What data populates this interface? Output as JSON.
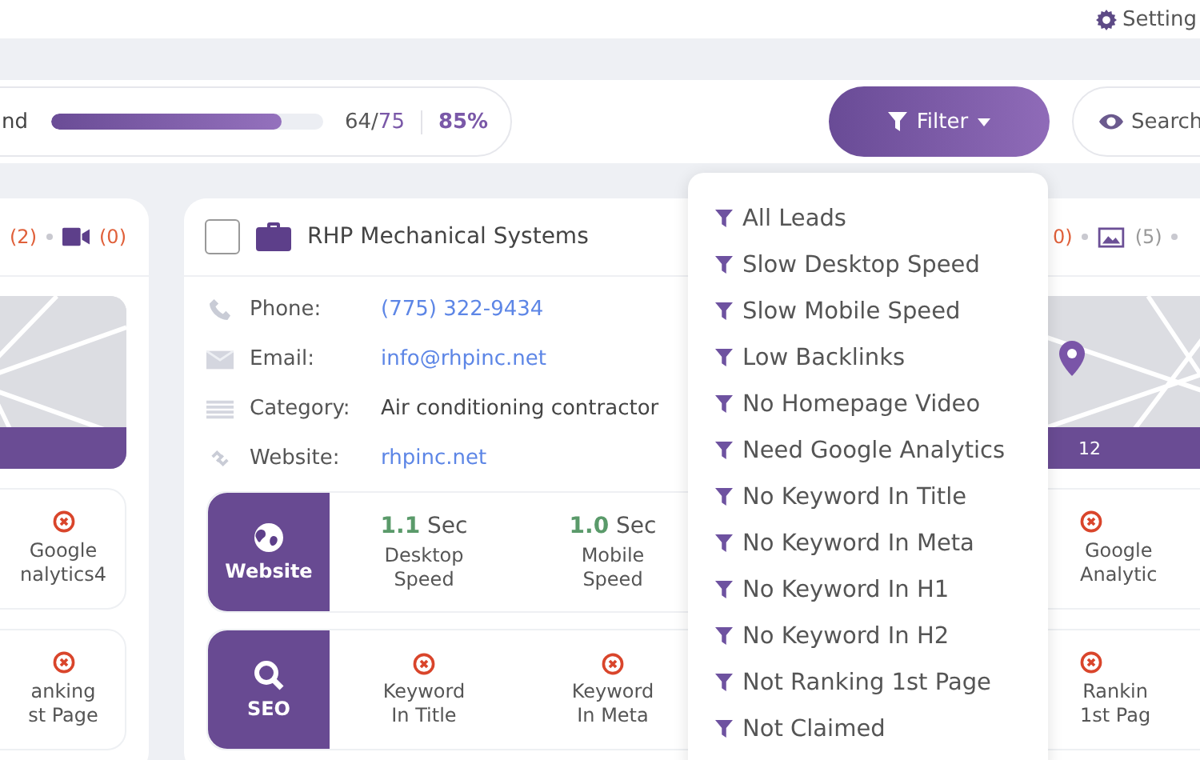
{
  "header": {
    "settings_label": "Setting"
  },
  "progress": {
    "label": "nd",
    "level": 0.85,
    "count": "64/",
    "total": "75",
    "percent": "85%"
  },
  "toolbar": {
    "filter_label": "Filter",
    "search_label": "Search"
  },
  "filter_menu": {
    "items": [
      "All Leads",
      "Slow Desktop Speed",
      "Slow Mobile Speed",
      "Low Backlinks",
      "No Homepage Video",
      "Need Google Analytics",
      "No Keyword In Title",
      "No Keyword In Meta",
      "No Keyword In H1",
      "No Keyword In H2",
      "Not Ranking 1st Page",
      "Not Claimed"
    ]
  },
  "left_card": {
    "counts": [
      {
        "kind": "plain",
        "text": "(2)",
        "color": "#e0603a"
      },
      {
        "kind": "video",
        "text": "(0)",
        "color": "#e0603a"
      }
    ],
    "checks": [
      {
        "caption": "Google\nnalytics4",
        "passed": false
      },
      {
        "caption": "anking\nst Page",
        "passed": false
      }
    ]
  },
  "main_card": {
    "checked": false,
    "title": "RHP Mechanical Systems",
    "fields": [
      {
        "kind": "phone",
        "label": "Phone:",
        "value": "(775) 322-9434",
        "link": true
      },
      {
        "kind": "email",
        "label": "Email:",
        "value": "info@rhpinc.net",
        "link": true
      },
      {
        "kind": "category",
        "label": "Category:",
        "value": "Air conditioning contractor",
        "link": false
      },
      {
        "kind": "website",
        "label": "Website:",
        "value": "rhpinc.net",
        "link": true
      }
    ],
    "sections": [
      {
        "kind": "website",
        "label": "Website",
        "metrics": [
          {
            "kind": "speed",
            "value": "1.1",
            "unit": "Sec",
            "caption": "Desktop\nSpeed"
          },
          {
            "kind": "speed",
            "value": "1.0",
            "unit": "Sec",
            "caption": "Mobile\nSpeed"
          }
        ]
      },
      {
        "kind": "seo",
        "label": "SEO",
        "metrics": [
          {
            "kind": "check",
            "passed": false,
            "caption": "Keyword\nIn Title"
          },
          {
            "kind": "check",
            "passed": false,
            "caption": "Keyword\nIn Meta"
          }
        ]
      }
    ]
  },
  "right_card": {
    "counts": [
      {
        "kind": "plain",
        "text": "0)",
        "color": "#e0603a"
      },
      {
        "kind": "image",
        "text": "(5)",
        "color": "#999999"
      }
    ],
    "map_bar_text": "12",
    "checks": [
      {
        "caption": "Google\nAnalytic",
        "passed": false
      },
      {
        "caption": "Rankin\n1st Pag",
        "passed": false
      }
    ]
  }
}
